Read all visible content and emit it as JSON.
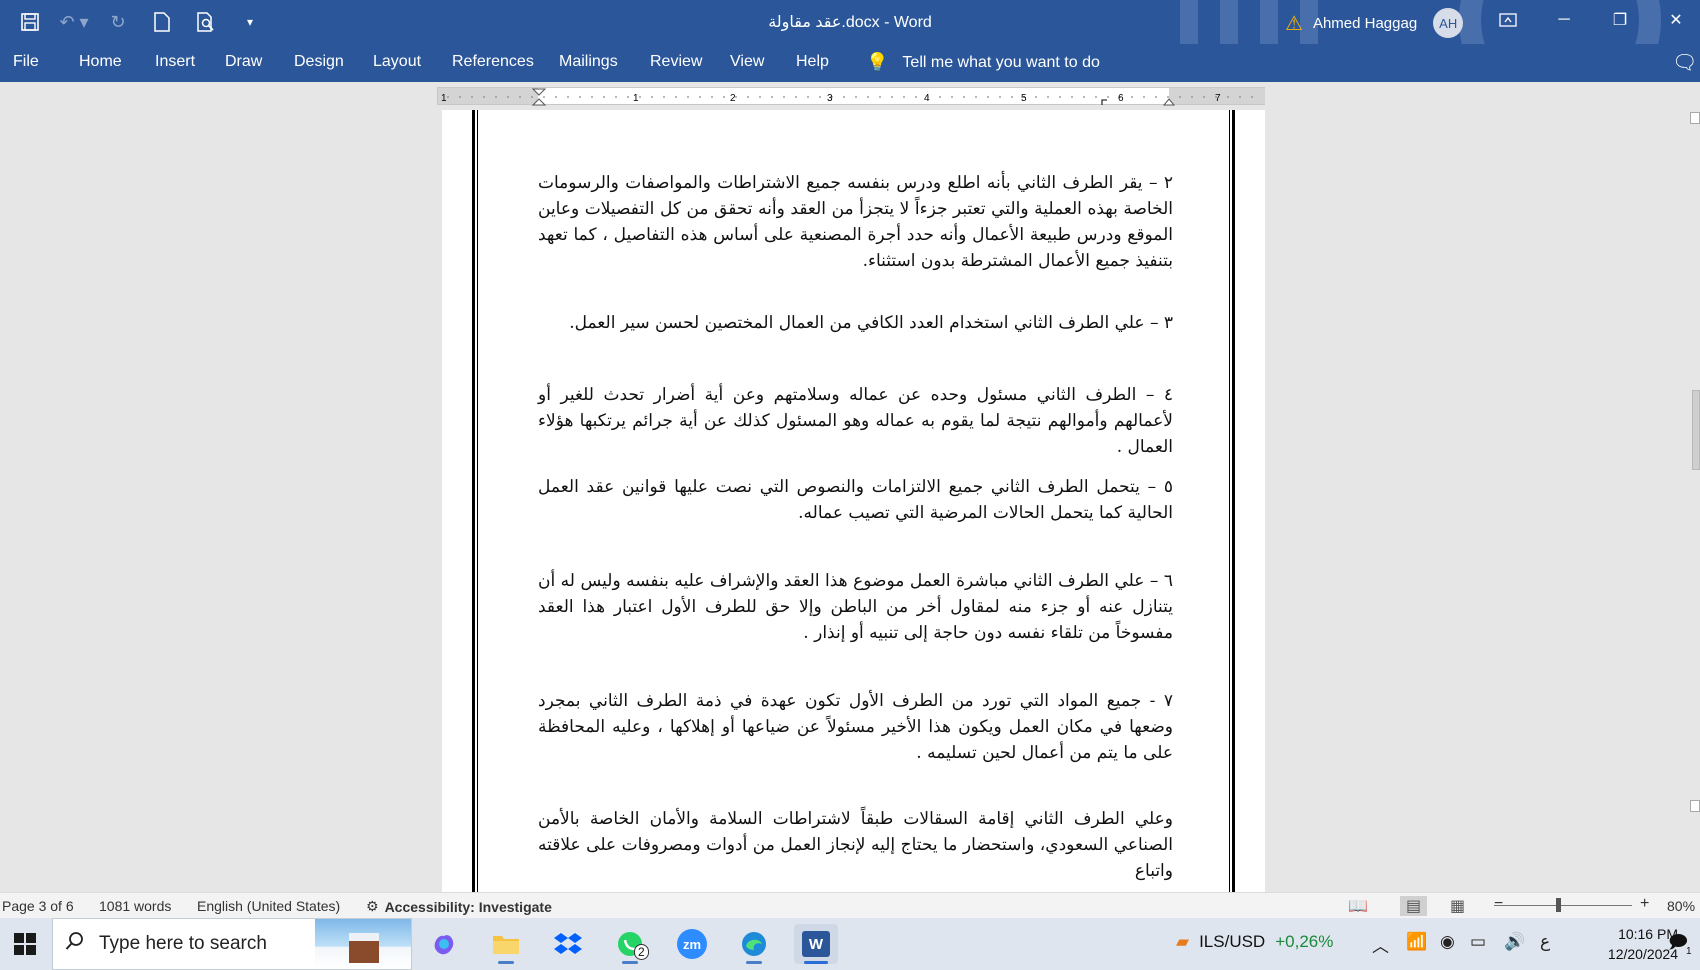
{
  "titlebar": {
    "doc_title": "عقد مقاولة.docx  -  Word",
    "user_name": "Ahmed Haggag",
    "user_initials": "AH",
    "icons": [
      "save-icon",
      "undo-icon",
      "redo-icon",
      "new-document-icon",
      "print-preview-icon",
      "customize-qat-icon",
      "warning-icon",
      "ribbon-display-icon",
      "minimize-icon",
      "restore-icon",
      "close-icon"
    ]
  },
  "menu": {
    "tabs": [
      "File",
      "Home",
      "Insert",
      "Draw",
      "Design",
      "Layout",
      "References",
      "Mailings",
      "Review",
      "View",
      "Help"
    ],
    "tell_me": "Tell me what you want to do"
  },
  "ruler": {
    "numbers": [
      "1",
      "1",
      "2",
      "3",
      "4",
      "5",
      "6",
      "7"
    ]
  },
  "document": {
    "paragraphs": [
      "٢ – يقر الطرف الثاني بأنه اطلع ودرس بنفسه جميع الاشتراطات والمواصفات والرسومات الخاصة بهذه العملية والتي تعتبر جزءاً لا يتجزأ من العقد وأنه تحقق من كل التفصيلات وعاين الموقع ودرس طبيعة الأعمال وأنه حدد أجرة المصنعية على أساس هذه التفاصيل ، كما تعهد بتنفيذ جميع الأعمال المشترطة بدون استثناء.",
      "٣ – علي الطرف الثاني استخدام العدد الكافي من العمال المختصين لحسن سير العمل.",
      "٤ – الطرف الثاني مسئول وحده عن عماله وسلامتهم وعن أية أضرار تحدث للغير أو لأعمالهم وأموالهم نتيجة لما يقوم به عماله وهو المسئول كذلك عن أية جرائم يرتكبها هؤلاء العمال .",
      "٥ – يتحمل الطرف الثاني جميع الالتزامات والنصوص التي نصت عليها قوانين عقد العمل الحالية كما يتحمل الحالات المرضية التي تصيب عماله.",
      "٦ – علي الطرف الثاني مباشرة العمل موضوع هذا العقد والإشراف عليه بنفسه وليس له أن يتنازل عنه أو جزء منه لمقاول أخر من الباطن وإلا حق للطرف الأول اعتبار هذا العقد مفسوخاً من تلقاء نفسه دون حاجة إلى تنبيه أو إنذار .",
      "٧ - جميع المواد التي تورد من الطرف الأول تكون عهدة في ذمة الطرف الثاني بمجرد وضعها في مكان العمل ويكون هذا الأخير مسئولاً عن ضياعها أو إهلاكها ، وعليه المحافظة على ما يتم من أعمال لحين تسليمه .",
      "وعلي الطرف الثاني إقامة السقالات طبقاً لاشتراطات السلامة والأمان الخاصة بالأمن الصناعي السعودي، واستحضار ما يحتاج إليه لإنجاز العمل من أدوات ومصروفات على علاقته واتباع"
    ]
  },
  "status": {
    "page": "Page 3 of 6",
    "words": "1081 words",
    "language": "English (United States)",
    "accessibility": "Accessibility: Investigate",
    "zoom_minus": "−",
    "zoom_plus": "+",
    "zoom": "80%"
  },
  "taskbar": {
    "search_placeholder": "Type here to search",
    "whatsapp_badge": "2",
    "zoom_label": "zm",
    "word_label": "W",
    "ticker_pair": "ILS/USD",
    "ticker_change": "+0,26%",
    "input_lang": "ع",
    "time": "10:16 PM",
    "date": "12/20/2024",
    "notifications": "1"
  },
  "colors": {
    "word_blue": "#2b579a",
    "warning": "#f7b500",
    "ticker_up": "#1a8a3a"
  }
}
